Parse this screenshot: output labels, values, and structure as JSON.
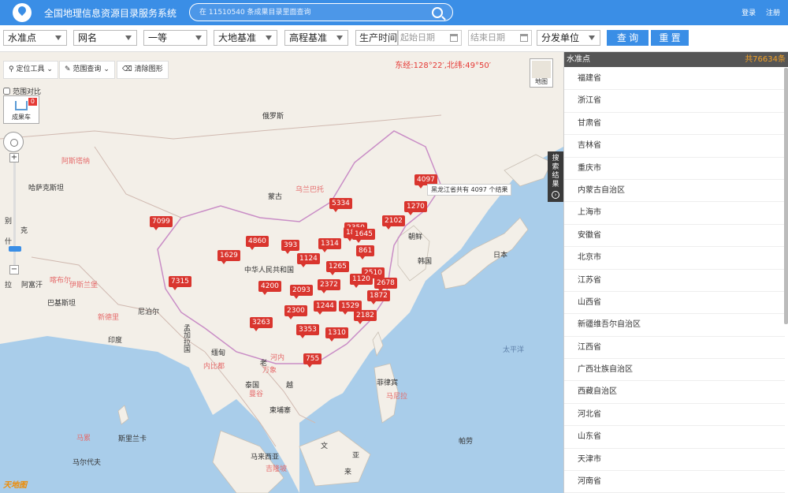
{
  "header": {
    "title": "全国地理信息资源目录服务系统",
    "search_placeholder": "在 11510540 条成果目录里面查询",
    "login": "登录",
    "register": "注册"
  },
  "filters": {
    "type": "水准点",
    "net": "网名",
    "grade": "一等",
    "datum": "大地基准",
    "height_datum": "高程基准",
    "time_label": "生产时间",
    "start_date": "起始日期",
    "end_date": "结束日期",
    "unit": "分发单位",
    "query": "查 询",
    "reset": "重 置"
  },
  "map": {
    "tools": {
      "locate": "定位工具",
      "range": "范围查询",
      "clear": "清除图形"
    },
    "coordinates": "东经:128°22′,北纬:49°50′",
    "map_switch": "地图",
    "compare": "范围对比",
    "cart": "成果车",
    "cart_count": "0",
    "tooltip": "黑龙江省共有 4097 个结果",
    "result_tab": [
      "搜",
      "索",
      "结",
      "果"
    ],
    "labels": {
      "russia": "俄罗斯",
      "mongolia": "蒙古",
      "ulaanbaatar": "乌兰巴托",
      "astana": "阿斯塔纳",
      "kazakhstan": "哈萨克斯坦",
      "china": "中华人民共和国",
      "north_korea": "朝鲜",
      "south_korea": "韩国",
      "japan": "日本",
      "pacific": "太平洋",
      "india": "印度",
      "nepal": "尼泊尔",
      "pakistan": "巴基斯坦",
      "afghanistan": "阿富汗",
      "kabul": "喀布尔",
      "islamabad": "伊斯兰堡",
      "new_delhi": "新德里",
      "bangladesh": "孟加拉国",
      "dhaka": "达卡",
      "myanmar": "缅甸",
      "naypyidaw": "内比都",
      "laos": "老",
      "vientiane": "万象",
      "hanoi": "河内",
      "thailand": "泰国",
      "bangkok": "曼谷",
      "vietnam": "越",
      "cambodia": "柬埔寨",
      "philippines": "菲律宾",
      "manila": "马尼拉",
      "sri_lanka": "斯里兰卡",
      "male": "马累",
      "maldives": "马尔代夫",
      "malaysia": "马来西亚",
      "kuala_lumpur": "吉隆坡",
      "indonesia": "亚",
      "palau": "帕劳",
      "brunei": "文",
      "west_edge_1": "别",
      "west_edge_2": "克",
      "west_edge_3": "什",
      "borneo": "来",
      "west_edge_4": "拉"
    },
    "markers": [
      "4097",
      "5334",
      "1270",
      "2102",
      "7099",
      "2350",
      "1838",
      "1645",
      "4860",
      "393",
      "1314",
      "1629",
      "861",
      "1124",
      "1265",
      "2510",
      "1120",
      "2678",
      "7315",
      "4200",
      "2093",
      "2372",
      "1872",
      "1244",
      "1529",
      "2300",
      "2182",
      "3263",
      "3353",
      "1310",
      "755"
    ]
  },
  "sidebar": {
    "header": "水准点",
    "total": "共76634条",
    "items": [
      "福建省",
      "浙江省",
      "甘肃省",
      "吉林省",
      "重庆市",
      "内蒙古自治区",
      "上海市",
      "安徽省",
      "北京市",
      "江苏省",
      "山西省",
      "新疆维吾尔自治区",
      "江西省",
      "广西壮族自治区",
      "西藏自治区",
      "河北省",
      "山东省",
      "天津市",
      "河南省"
    ]
  },
  "colors": {
    "primary": "#3a8ee6",
    "marker": "#d9352e",
    "sea": "#a9cdea",
    "land": "#f3efe8",
    "coord": "#e53935",
    "total": "#f3a126"
  }
}
